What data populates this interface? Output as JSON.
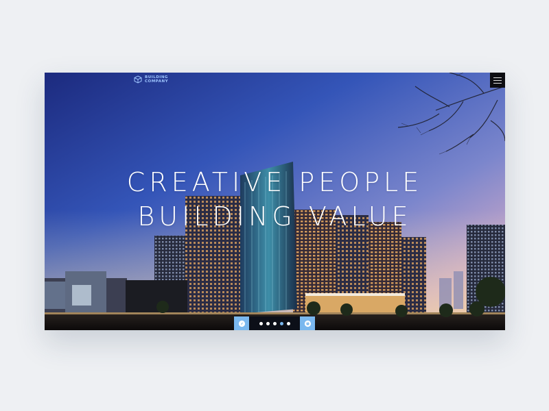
{
  "brand": {
    "line1": "BUILDING",
    "line2": "COMPANY",
    "logo_icon": "cube-logo-icon",
    "color": "#9ec5ff"
  },
  "nav": {
    "menu_icon": "hamburger-menu-icon"
  },
  "hero": {
    "headline_line1": "CREATIVE PEOPLE",
    "headline_line2": "BUILDING VALUE",
    "background": "night-city-towers-illustration"
  },
  "slider": {
    "prev_icon": "compass-icon",
    "next_icon": "basket-icon",
    "slide_count": 5,
    "active_slide": 4,
    "accent": "#7ab8ef"
  }
}
